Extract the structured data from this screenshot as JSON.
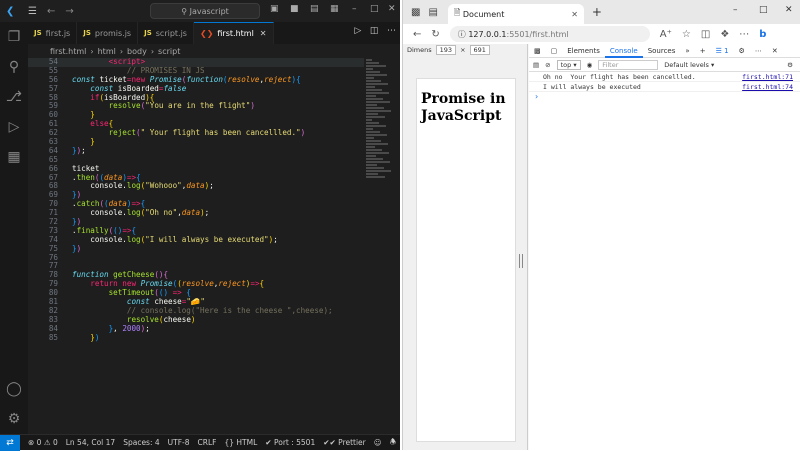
{
  "vscode": {
    "title": "Javascript",
    "tabs": [
      {
        "label": "first.js",
        "active": false
      },
      {
        "label": "promis.js",
        "active": false
      },
      {
        "label": "script.js",
        "active": false
      },
      {
        "label": "first.html",
        "active": true
      }
    ],
    "breadcrumb": [
      "first.html",
      "html",
      "body",
      "script"
    ],
    "code_lines": [
      {
        "n": "54",
        "html": "        <span class='tag'>&lt;script&gt;</span>"
      },
      {
        "n": "55",
        "html": "            <span class='cm'>// PROMISES IN JS</span>"
      },
      {
        "n": "56",
        "html": "<span class='it'>const</span> <span class='pl'>ticket</span><span class='kw'>=new</span> <span class='it'>Promise</span><span class='br1'>(</span><span class='it'>function</span><span class='br2'>(</span><span class='par'>resolve</span><span class='pl'>,</span><span class='par'>reject</span><span class='br2'>)</span><span class='br2'>{</span>"
      },
      {
        "n": "57",
        "html": "    <span class='it'>const</span> <span class='pl'>isBoarded</span><span class='kw'>=</span><span class='it'>false</span>"
      },
      {
        "n": "58",
        "html": "    <span class='kw'>if</span><span class='br3'>(</span><span class='pl'>isBoarded</span><span class='br3'>)</span><span class='br3'>{</span>"
      },
      {
        "n": "59",
        "html": "        <span class='fn'>resolve</span><span class='br1'>(</span><span class='str'>\"You are in the flight\"</span><span class='br1'>)</span>"
      },
      {
        "n": "60",
        "html": "    <span class='br3'>}</span>"
      },
      {
        "n": "61",
        "html": "    <span class='kw'>else</span><span class='br3'>{</span>"
      },
      {
        "n": "62",
        "html": "        <span class='fn'>reject</span><span class='br1'>(</span><span class='str'>\" Your flight has been cancellled.\"</span><span class='br1'>)</span>"
      },
      {
        "n": "63",
        "html": "    <span class='br3'>}</span>"
      },
      {
        "n": "64",
        "html": "<span class='br2'>}</span><span class='br1'>)</span><span class='pl'>;</span>"
      },
      {
        "n": "65",
        "html": ""
      },
      {
        "n": "66",
        "html": "<span class='pl'>ticket</span>"
      },
      {
        "n": "67",
        "html": "<span class='pl'>.</span><span class='fn'>then</span><span class='br1'>(</span><span class='br2'>(</span><span class='par'>data</span><span class='br2'>)</span><span class='kw'>=&gt;</span><span class='br2'>{</span>"
      },
      {
        "n": "68",
        "html": "    <span class='pl'>console.</span><span class='fn'>log</span><span class='br3'>(</span><span class='str'>\"Wohooo\"</span><span class='pl'>,</span><span class='par'>data</span><span class='br3'>)</span><span class='pl'>;</span>"
      },
      {
        "n": "69",
        "html": "<span class='br2'>}</span><span class='br1'>)</span>"
      },
      {
        "n": "70",
        "html": "<span class='pl'>.</span><span class='fn'>catch</span><span class='br1'>(</span><span class='br2'>(</span><span class='par'>data</span><span class='br2'>)</span><span class='kw'>=&gt;</span><span class='br2'>{</span>"
      },
      {
        "n": "71",
        "html": "    <span class='pl'>console.</span><span class='fn'>log</span><span class='br3'>(</span><span class='str'>\"Oh no\"</span><span class='pl'>,</span><span class='par'>data</span><span class='br3'>)</span><span class='pl'>;</span>"
      },
      {
        "n": "72",
        "html": "<span class='br2'>}</span><span class='br1'>)</span>"
      },
      {
        "n": "73",
        "html": "<span class='pl'>.</span><span class='fn'>finally</span><span class='br1'>(</span><span class='br2'>()</span><span class='kw'>=&gt;</span><span class='br2'>{</span>"
      },
      {
        "n": "74",
        "html": "    <span class='pl'>console.</span><span class='fn'>log</span><span class='br3'>(</span><span class='str'>\"I will always be executed\"</span><span class='br3'>)</span><span class='pl'>;</span>"
      },
      {
        "n": "75",
        "html": "<span class='br2'>}</span><span class='br1'>)</span>"
      },
      {
        "n": "76",
        "html": ""
      },
      {
        "n": "77",
        "html": ""
      },
      {
        "n": "78",
        "html": "<span class='it'>function</span> <span class='fn'>getCheese</span><span class='br1'>()</span><span class='br1'>{</span>"
      },
      {
        "n": "79",
        "html": "    <span class='kw'>return new</span> <span class='it'>Promise</span><span class='br2'>(</span><span class='br3'>(</span><span class='par'>resolve</span><span class='pl'>,</span><span class='par'>reject</span><span class='br3'>)</span><span class='kw'>=&gt;</span><span class='br3'>{</span>"
      },
      {
        "n": "80",
        "html": "        <span class='fn'>setTimeout</span><span class='br1'>(</span><span class='br2'>()</span> <span class='kw'>=&gt;</span> <span class='br2'>{</span>"
      },
      {
        "n": "81",
        "html": "            <span class='it'>const</span> <span class='pl'>cheese</span><span class='kw'>=</span><span class='str'>\"&#129472;\"</span>"
      },
      {
        "n": "82",
        "html": "            <span class='cm'>// console.log(\"Here is the cheese \",cheese);</span>"
      },
      {
        "n": "83",
        "html": "            <span class='fn'>resolve</span><span class='br3'>(</span><span class='pl'>cheese</span><span class='br3'>)</span>"
      },
      {
        "n": "84",
        "html": "        <span class='br2'>}</span><span class='pl'>, </span><span class='par' style='color:#ae81ff;font-style:normal'>2000</span><span class='br1'>)</span><span class='pl'>;</span>"
      },
      {
        "n": "85",
        "html": "    <span class='br3'>}</span><span class='br2'>)</span>"
      }
    ],
    "status": {
      "errors": "0",
      "warnings": "0",
      "position": "Ln 54, Col 17",
      "spaces": "Spaces: 4",
      "encoding": "UTF-8",
      "eol": "CRLF",
      "lang": "HTML",
      "port": "Port : 5501",
      "prettier": "Prettier"
    }
  },
  "browser": {
    "tab_title": "Document",
    "url_host": "127.0.0.1",
    "url_path": ":5501/first.html",
    "dimensions_label": "Dimens",
    "width": "193",
    "height": "691",
    "page_heading": "Promise in JavaScript",
    "devtools_tabs": [
      "Elements",
      "Console",
      "Sources"
    ],
    "issue_count": "1",
    "context": "top",
    "filter_placeholder": "Filter",
    "levels": "Default levels",
    "console_lines": [
      {
        "text": "Oh no  Your flight has been cancellled.",
        "source": "first.html:71"
      },
      {
        "text": "I will always be executed",
        "source": "first.html:74"
      }
    ]
  }
}
